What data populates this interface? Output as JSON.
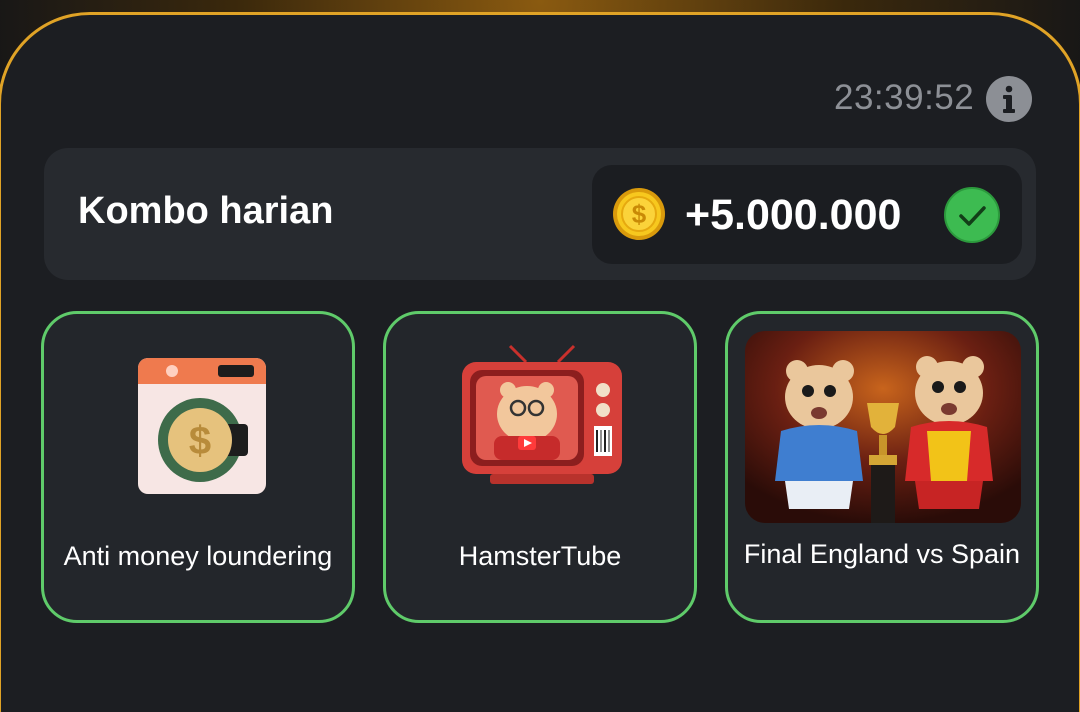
{
  "header": {
    "timer": "23:39:52"
  },
  "combo": {
    "title": "Kombo harian",
    "reward": "+5.000.000"
  },
  "cards": [
    {
      "label": "Anti money loundering",
      "icon": "wallet-coin-icon"
    },
    {
      "label": "HamsterTube",
      "icon": "hamster-tv-icon"
    },
    {
      "label": "Final England vs Spain",
      "icon": "hamsters-trophy-image"
    }
  ],
  "colors": {
    "accent_gold": "#e0a326",
    "card_border_green": "#5fcb6a",
    "check_green": "#3dbb51",
    "coin_yellow": "#f5c518"
  }
}
